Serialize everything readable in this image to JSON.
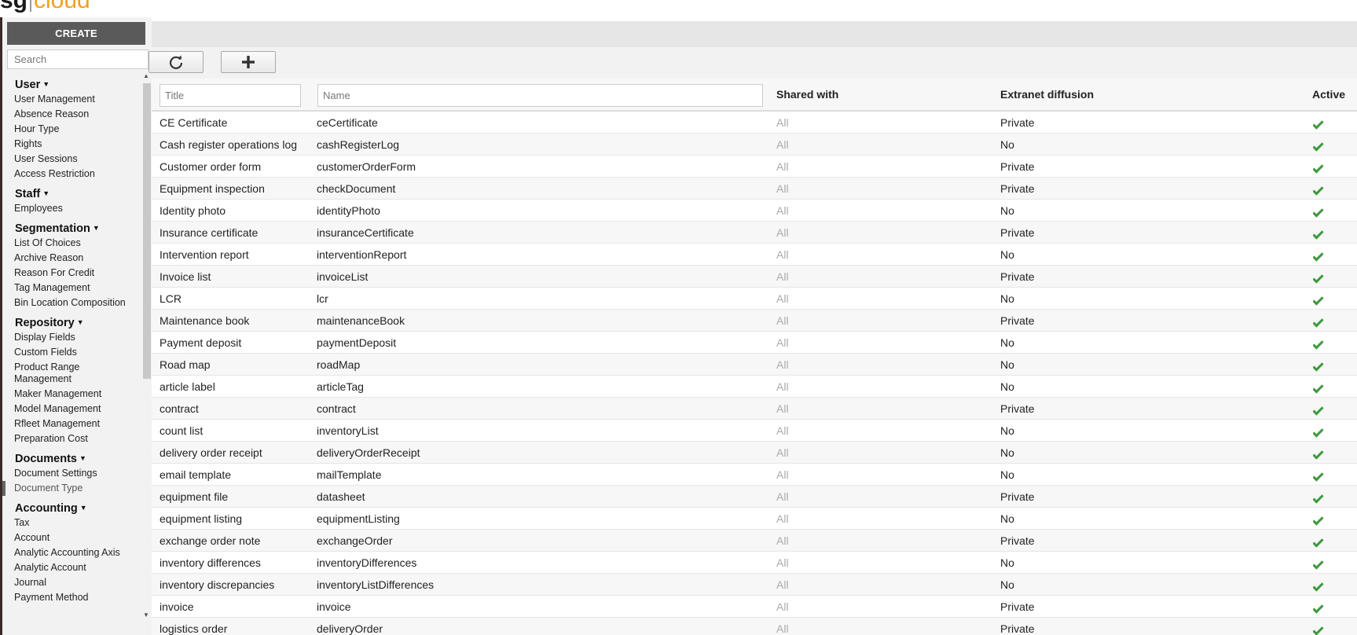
{
  "logo": {
    "part1": "sg",
    "part2": "cloud"
  },
  "sidebar": {
    "create_label": "CREATE",
    "search_placeholder": "Search",
    "groups": [
      {
        "title": "User",
        "items": [
          "User Management",
          "Absence Reason",
          "Hour Type",
          "Rights",
          "User Sessions",
          "Access Restriction"
        ]
      },
      {
        "title": "Staff",
        "items": [
          "Employees"
        ]
      },
      {
        "title": "Segmentation",
        "items": [
          "List Of Choices",
          "Archive Reason",
          "Reason For Credit",
          "Tag Management",
          "Bin Location Composition"
        ]
      },
      {
        "title": "Repository",
        "items": [
          "Display Fields",
          "Custom Fields",
          "Product Range Management",
          "Maker Management",
          "Model Management",
          "Rfleet Management",
          "Preparation Cost"
        ]
      },
      {
        "title": "Documents",
        "items": [
          "Document Settings",
          "Document Type"
        ]
      },
      {
        "title": "Accounting",
        "items": [
          "Tax",
          "Account",
          "Analytic Accounting Axis",
          "Analytic Account",
          "Journal",
          "Payment Method"
        ]
      }
    ],
    "active_item": "Document Type"
  },
  "toolbar": {
    "refresh_icon": "refresh-icon",
    "add_icon": "plus-icon"
  },
  "table": {
    "filters": {
      "title_placeholder": "Title",
      "name_placeholder": "Name"
    },
    "headers": {
      "shared": "Shared with",
      "extranet": "Extranet diffusion",
      "active": "Active"
    },
    "rows": [
      {
        "title": "CE Certificate",
        "name": "ceCertificate",
        "shared": "All",
        "extranet": "Private",
        "active": true
      },
      {
        "title": "Cash register operations log",
        "name": "cashRegisterLog",
        "shared": "All",
        "extranet": "No",
        "active": true
      },
      {
        "title": "Customer order form",
        "name": "customerOrderForm",
        "shared": "All",
        "extranet": "Private",
        "active": true
      },
      {
        "title": "Equipment inspection",
        "name": "checkDocument",
        "shared": "All",
        "extranet": "Private",
        "active": true
      },
      {
        "title": "Identity photo",
        "name": "identityPhoto",
        "shared": "All",
        "extranet": "No",
        "active": true
      },
      {
        "title": "Insurance certificate",
        "name": "insuranceCertificate",
        "shared": "All",
        "extranet": "Private",
        "active": true
      },
      {
        "title": "Intervention report",
        "name": "interventionReport",
        "shared": "All",
        "extranet": "No",
        "active": true
      },
      {
        "title": "Invoice list",
        "name": "invoiceList",
        "shared": "All",
        "extranet": "Private",
        "active": true
      },
      {
        "title": "LCR",
        "name": "lcr",
        "shared": "All",
        "extranet": "No",
        "active": true
      },
      {
        "title": "Maintenance book",
        "name": "maintenanceBook",
        "shared": "All",
        "extranet": "Private",
        "active": true
      },
      {
        "title": "Payment deposit",
        "name": "paymentDeposit",
        "shared": "All",
        "extranet": "No",
        "active": true
      },
      {
        "title": "Road map",
        "name": "roadMap",
        "shared": "All",
        "extranet": "No",
        "active": true
      },
      {
        "title": "article label",
        "name": "articleTag",
        "shared": "All",
        "extranet": "No",
        "active": true
      },
      {
        "title": "contract",
        "name": "contract",
        "shared": "All",
        "extranet": "Private",
        "active": true
      },
      {
        "title": "count list",
        "name": "inventoryList",
        "shared": "All",
        "extranet": "No",
        "active": true
      },
      {
        "title": "delivery order receipt",
        "name": "deliveryOrderReceipt",
        "shared": "All",
        "extranet": "No",
        "active": true
      },
      {
        "title": "email template",
        "name": "mailTemplate",
        "shared": "All",
        "extranet": "No",
        "active": true
      },
      {
        "title": "equipment file",
        "name": "datasheet",
        "shared": "All",
        "extranet": "Private",
        "active": true
      },
      {
        "title": "equipment listing",
        "name": "equipmentListing",
        "shared": "All",
        "extranet": "No",
        "active": true
      },
      {
        "title": "exchange order note",
        "name": "exchangeOrder",
        "shared": "All",
        "extranet": "Private",
        "active": true
      },
      {
        "title": "inventory differences",
        "name": "inventoryDifferences",
        "shared": "All",
        "extranet": "No",
        "active": true
      },
      {
        "title": "inventory discrepancies",
        "name": "inventoryListDifferences",
        "shared": "All",
        "extranet": "No",
        "active": true
      },
      {
        "title": "invoice",
        "name": "invoice",
        "shared": "All",
        "extranet": "Private",
        "active": true
      },
      {
        "title": "logistics order",
        "name": "deliveryOrder",
        "shared": "All",
        "extranet": "Private",
        "active": true
      }
    ]
  }
}
